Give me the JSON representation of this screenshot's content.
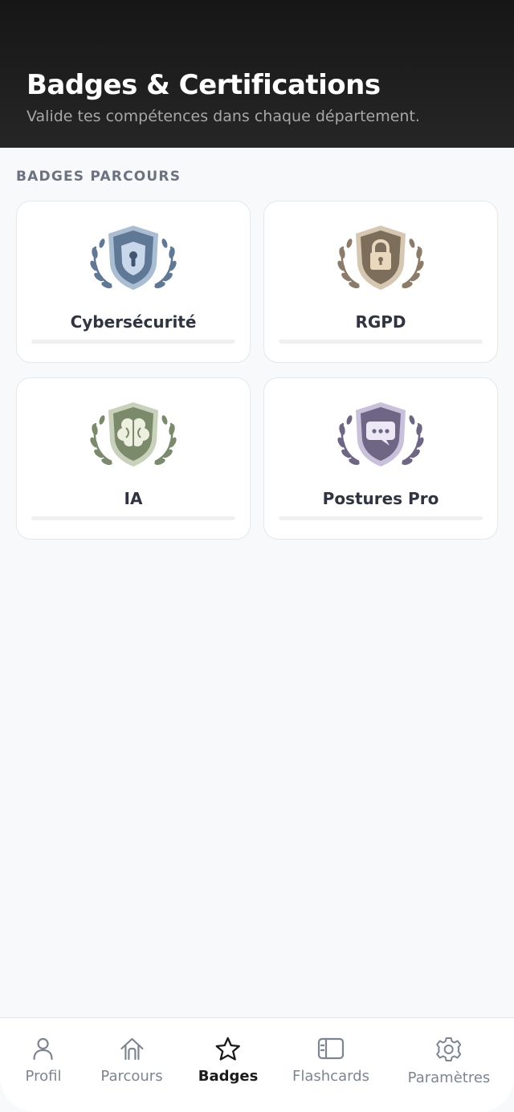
{
  "header": {
    "title": "Badges & Certifications",
    "subtitle": "Valide tes compétences dans chaque département."
  },
  "section": {
    "title": "BADGES PARCOURS"
  },
  "badges": [
    {
      "label": "Cybersécurité",
      "icon": "keyhole-shield-icon",
      "color": "#6f87a4",
      "progress": 0
    },
    {
      "label": "RGPD",
      "icon": "padlock-icon",
      "color": "#8b7b68",
      "progress": 0
    },
    {
      "label": "IA",
      "icon": "brain-icon",
      "color": "#7c8a6c",
      "progress": 0
    },
    {
      "label": "Postures Pro",
      "icon": "chat-bubble-icon",
      "color": "#6f6585",
      "progress": 0
    }
  ],
  "tabs": [
    {
      "label": "Profil",
      "icon": "person-icon",
      "active": false
    },
    {
      "label": "Parcours",
      "icon": "home-icon",
      "active": false
    },
    {
      "label": "Badges",
      "icon": "star-icon",
      "active": true
    },
    {
      "label": "Flashcards",
      "icon": "card-icon",
      "active": false
    },
    {
      "label": "Paramètres",
      "icon": "gear-icon",
      "active": false
    }
  ]
}
